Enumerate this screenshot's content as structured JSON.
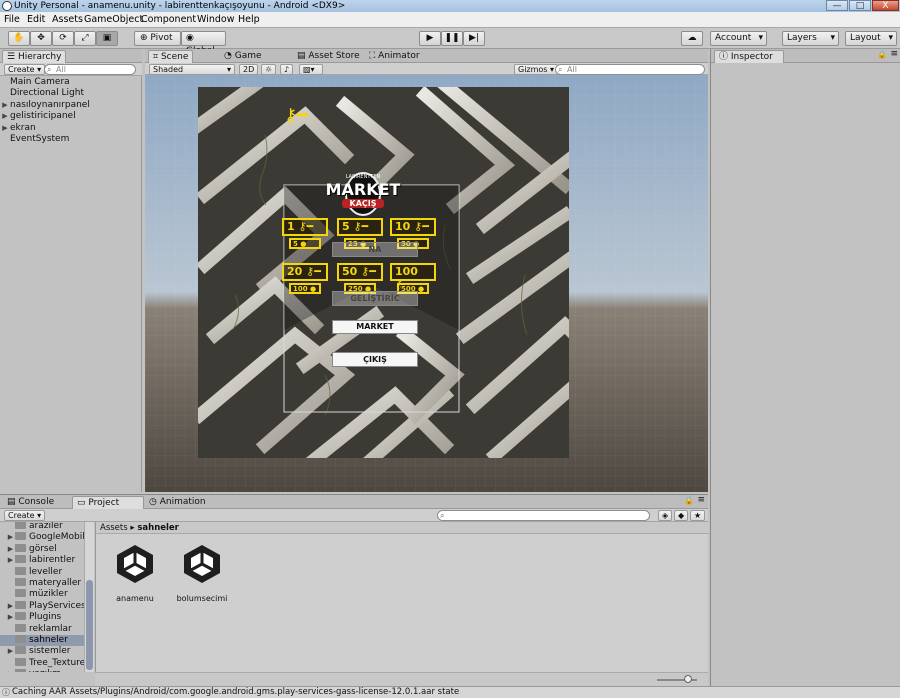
{
  "window": {
    "title": "Unity Personal - anamenu.unity - labirenttenkaçışoyunu - Android <DX9>",
    "min": "—",
    "max": "□",
    "close": "X"
  },
  "menubar": [
    "File",
    "Edit",
    "Assets",
    "GameObject",
    "Component",
    "Window",
    "Help"
  ],
  "toolbar": {
    "pivot": "Pivot",
    "global": "Global",
    "account": "Account",
    "layers": "Layers",
    "layout": "Layout"
  },
  "hierarchy": {
    "tab": "Hierarchy",
    "create": "Create",
    "search_placeholder": "All",
    "items": [
      {
        "label": "Main Camera",
        "expandable": false
      },
      {
        "label": "Directional Light",
        "expandable": false
      },
      {
        "label": "nasıloynanırpanel",
        "expandable": true
      },
      {
        "label": "gelistiricipanel",
        "expandable": true
      },
      {
        "label": "ekran",
        "expandable": true
      },
      {
        "label": "EventSystem",
        "expandable": false
      }
    ]
  },
  "scene": {
    "tabs": [
      "Scene",
      "Game",
      "Asset Store",
      "Animator"
    ],
    "shading": "Shaded",
    "mode2d": "2D",
    "gizmos": "Gizmos",
    "search_placeholder": "All"
  },
  "game_ui": {
    "logo_title": "MARKET",
    "logo_sub": "KAÇIŞ",
    "logo_top": "LABIRENTTEN",
    "keys": [
      {
        "count": "1",
        "price": "5"
      },
      {
        "count": "5",
        "price": "25"
      },
      {
        "count": "10",
        "price": "50"
      },
      {
        "count": "20",
        "price": "100"
      },
      {
        "count": "50",
        "price": "250"
      },
      {
        "count": "100",
        "price": "500"
      }
    ],
    "hidden_btn_1": "NA",
    "hidden_btn_2": "GELİŞTİRİC",
    "market_button": "MARKET",
    "exit_button": "ÇIKIŞ"
  },
  "inspector": {
    "tab": "Inspector"
  },
  "bottom": {
    "tabs": [
      "Console",
      "Project",
      "Animation"
    ],
    "create": "Create",
    "breadcrumb_root": "Assets",
    "breadcrumb_current": "sahneler",
    "folders": [
      {
        "label": "araziler",
        "expandable": false
      },
      {
        "label": "GoogleMobileAds",
        "expandable": true
      },
      {
        "label": "görsel",
        "expandable": true
      },
      {
        "label": "labirentler",
        "expandable": true
      },
      {
        "label": "leveller",
        "expandable": false
      },
      {
        "label": "materyaller",
        "expandable": false
      },
      {
        "label": "müzikler",
        "expandable": false
      },
      {
        "label": "PlayServicesResolver",
        "expandable": true
      },
      {
        "label": "Plugins",
        "expandable": true
      },
      {
        "label": "reklamlar",
        "expandable": false
      },
      {
        "label": "sahneler",
        "expandable": false,
        "selected": true
      },
      {
        "label": "sistemler",
        "expandable": true
      },
      {
        "label": "Tree_Textures",
        "expandable": false
      },
      {
        "label": "yazılım",
        "expandable": true
      }
    ],
    "assets": [
      "anamenu",
      "bolumsecimi"
    ]
  },
  "status": "Caching AAR Assets/Plugins/Android/com.google.android.gms.play-services-gass-license-12.0.1.aar state",
  "colors": {
    "accent_yellow": "#f5d60a",
    "selection": "#8f9aad"
  }
}
